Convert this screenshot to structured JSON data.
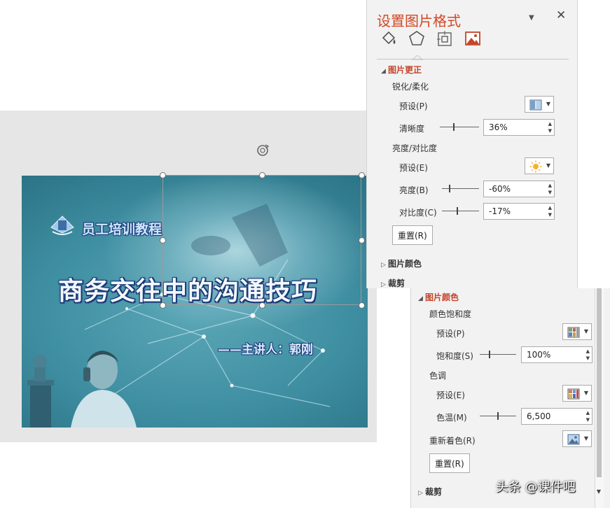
{
  "slide": {
    "brand": "员工培训教程",
    "title": "商务交往中的沟通技巧",
    "presenter": "——主讲人：郭刚"
  },
  "panel": {
    "title": "设置图片格式",
    "tabs": [
      "fill-line-icon",
      "effects-icon",
      "size-properties-icon",
      "picture-icon"
    ],
    "correction": {
      "header": "图片更正",
      "sharpen_group": "锐化/柔化",
      "sharpen_preset_label": "预设(P)",
      "sharpness_label": "清晰度",
      "sharpness_value": "36%",
      "sharpness_fraction": 0.36,
      "brightness_group": "亮度/对比度",
      "brightness_preset_label": "预设(E)",
      "brightness_label": "亮度(B)",
      "brightness_value": "-60%",
      "brightness_fraction": 0.2,
      "contrast_label": "对比度(C)",
      "contrast_value": "-17%",
      "contrast_fraction": 0.415,
      "reset_label": "重置(R)"
    },
    "color_collapsed": "图片颜色",
    "crop_collapsed": "裁剪"
  },
  "panel2": {
    "color": {
      "header": "图片颜色",
      "saturation_group": "颜色饱和度",
      "saturation_preset_label": "预设(P)",
      "saturation_label": "饱和度(S)",
      "saturation_value": "100%",
      "saturation_fraction": 0.25,
      "tone_group": "色调",
      "tone_preset_label": "预设(E)",
      "temperature_label": "色温(M)",
      "temperature_value": "6,500",
      "temperature_fraction": 0.5,
      "recolor_label": "重新着色(R)",
      "reset_label": "重置(R)"
    },
    "crop_collapsed": "裁剪"
  },
  "colors": {
    "accent": "#d24726",
    "panel_bg": "#f2f2f2",
    "slide_teal": "#3f8fa2"
  },
  "watermark": "头条 @课件吧"
}
